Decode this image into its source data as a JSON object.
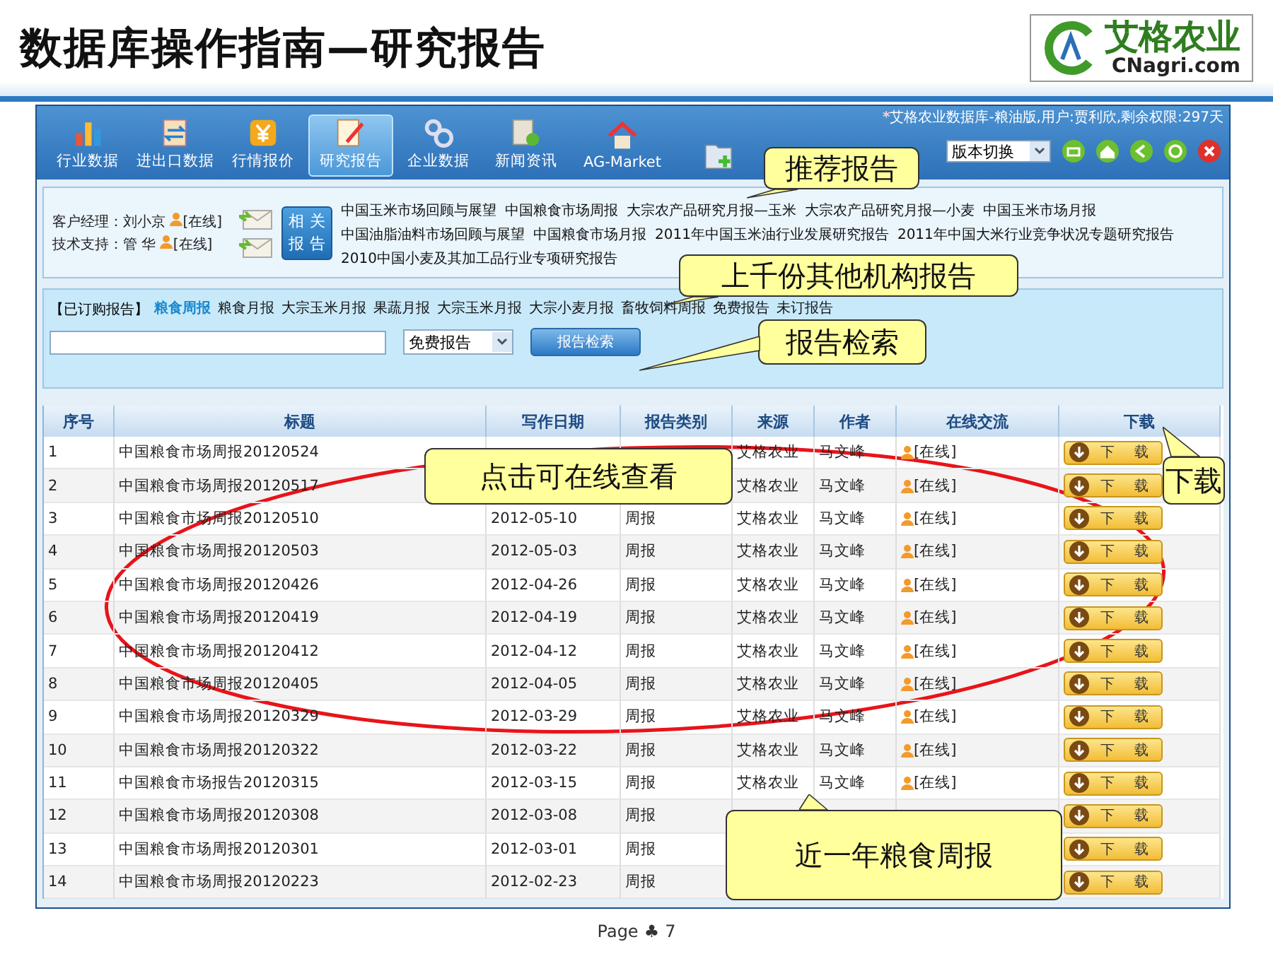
{
  "slide": {
    "title": "数据库操作指南—研究报告",
    "logo_text": "艾格农业",
    "logo_domain": "CNagri.com",
    "page_label": "Page",
    "page_symbol": "♣",
    "page_number": "7"
  },
  "window": {
    "status_mark": "*",
    "status_text": "艾格农业数据库-粮油版,用户:贾利欣,剩余权限:297天"
  },
  "toolbar": {
    "items": [
      {
        "label": "行业数据",
        "selected": false
      },
      {
        "label": "进出口数据",
        "selected": false
      },
      {
        "label": "行情报价",
        "selected": false
      },
      {
        "label": "研究报告",
        "selected": true
      },
      {
        "label": "企业数据",
        "selected": false
      },
      {
        "label": "新闻资讯",
        "selected": false
      },
      {
        "label": "AG-Market",
        "selected": false
      },
      {
        "selected": false
      }
    ],
    "version_select": {
      "value": "版本切换"
    },
    "round_buttons": [
      {
        "kind": "window",
        "color": "#6cbf2e"
      },
      {
        "kind": "home",
        "color": "#6cbf2e"
      },
      {
        "kind": "back",
        "color": "#6cbf2e"
      },
      {
        "kind": "refresh",
        "color": "#6cbf2e"
      },
      {
        "kind": "close",
        "color": "#e0302a"
      }
    ]
  },
  "contacts": [
    {
      "role": "客户经理：",
      "name": "刘小京",
      "status": "[在线]"
    },
    {
      "role": "技术支持：",
      "name": "管  华",
      "status": "[在线]"
    }
  ],
  "related_button": "相关报告",
  "recommended": [
    "中国玉米市场回顾与展望",
    "中国粮食市场周报",
    "大宗农产品研究月报—玉米",
    "大宗农产品研究月报—小麦",
    "中国玉米市场月报",
    "中国油脂油料市场回顾与展望",
    "中国粮食市场月报",
    "2011年中国玉米油行业发展研究报告",
    "2011年中国大米行业竞争状况专题研究报告",
    "2010中国小麦及其加工品行业专项研究报告"
  ],
  "subscribed": {
    "label": "【已订购报告】",
    "items": [
      {
        "label": "粮食周报",
        "selected": true
      },
      {
        "label": "粮食月报",
        "selected": false
      },
      {
        "label": "大宗玉米月报",
        "selected": false
      },
      {
        "label": "果蔬月报",
        "selected": false
      },
      {
        "label": "大宗玉米月报",
        "selected": false
      },
      {
        "label": "大宗小麦月报",
        "selected": false
      },
      {
        "label": "畜牧饲料周报",
        "selected": false
      },
      {
        "label": "免费报告",
        "selected": false
      },
      {
        "label": "未订报告",
        "selected": false
      }
    ]
  },
  "search": {
    "select_value": "免费报告",
    "button": "报告检索"
  },
  "table": {
    "columns": [
      "序号",
      "标题",
      "写作日期",
      "报告类别",
      "来源",
      "作者",
      "在线交流",
      "下载"
    ],
    "rows": [
      {
        "no": "1",
        "title": "中国粮食市场周报20120524",
        "source": "艾格农业",
        "author": "马文峰",
        "online": "[在线]",
        "download": "下载"
      },
      {
        "no": "2",
        "title": "中国粮食市场周报20120517",
        "source": "艾格农业",
        "author": "马文峰",
        "online": "[在线]",
        "download": "下载"
      },
      {
        "no": "3",
        "title": "中国粮食市场周报20120510",
        "date": "2012-05-10",
        "category": "周报",
        "source": "艾格农业",
        "author": "马文峰",
        "online": "[在线]",
        "download": "下载"
      },
      {
        "no": "4",
        "title": "中国粮食市场周报20120503",
        "date": "2012-05-03",
        "category": "周报",
        "source": "艾格农业",
        "author": "马文峰",
        "online": "[在线]",
        "download": "下载"
      },
      {
        "no": "5",
        "title": "中国粮食市场周报20120426",
        "date": "2012-04-26",
        "category": "周报",
        "source": "艾格农业",
        "author": "马文峰",
        "online": "[在线]",
        "download": "下载"
      },
      {
        "no": "6",
        "title": "中国粮食市场周报20120419",
        "date": "2012-04-19",
        "category": "周报",
        "source": "艾格农业",
        "author": "马文峰",
        "online": "[在线]",
        "download": "下载"
      },
      {
        "no": "7",
        "title": "中国粮食市场周报20120412",
        "date": "2012-04-12",
        "category": "周报",
        "source": "艾格农业",
        "author": "马文峰",
        "online": "[在线]",
        "download": "下载"
      },
      {
        "no": "8",
        "title": "中国粮食市场周报20120405",
        "date": "2012-04-05",
        "category": "周报",
        "source": "艾格农业",
        "author": "马文峰",
        "online": "[在线]",
        "download": "下载"
      },
      {
        "no": "9",
        "title": "中国粮食市场周报20120329",
        "date": "2012-03-29",
        "category": "周报",
        "source": "艾格农业",
        "author": "马文峰",
        "online": "[在线]",
        "download": "下载"
      },
      {
        "no": "10",
        "title": "中国粮食市场周报20120322",
        "date": "2012-03-22",
        "category": "周报",
        "source": "艾格农业",
        "author": "马文峰",
        "online": "[在线]",
        "download": "下载"
      },
      {
        "no": "11",
        "title": "中国粮食市场报告20120315",
        "date": "2012-03-15",
        "category": "周报",
        "source": "艾格农业",
        "author": "马文峰",
        "online": "[在线]",
        "download": "下载"
      },
      {
        "no": "12",
        "title": "中国粮食市场周报20120308",
        "date": "2012-03-08",
        "category": "周报",
        "download": "下载"
      },
      {
        "no": "13",
        "title": "中国粮食市场周报20120301",
        "date": "2012-03-01",
        "category": "周报",
        "download": "下载"
      },
      {
        "no": "14",
        "title": "中国粮食市场周报20120223",
        "date": "2012-02-23",
        "category": "周报",
        "download": "下载"
      }
    ]
  },
  "callouts": [
    {
      "text": "推荐报告"
    },
    {
      "text": "上千份其他机构报告"
    },
    {
      "text": "报告检索"
    },
    {
      "text": "点击可在线查看"
    },
    {
      "text": "下载"
    },
    {
      "text": "近一年粮食周报"
    }
  ]
}
